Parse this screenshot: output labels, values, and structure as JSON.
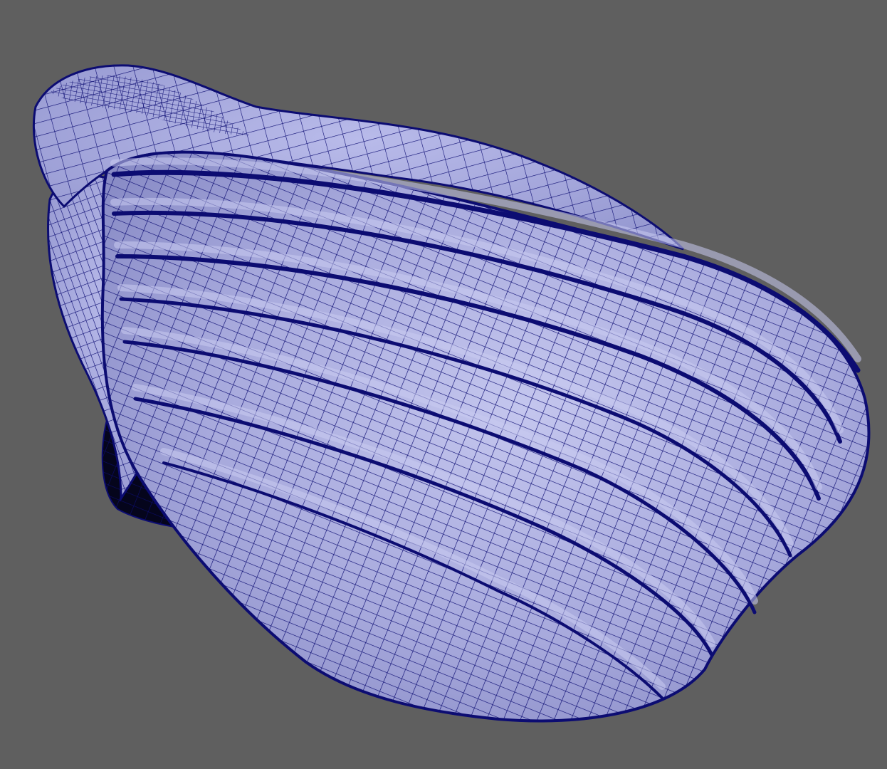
{
  "viewport": {
    "background_color": "#5f5f5f",
    "display_mode": "wireframe-on-shaded",
    "model": {
      "kind": "shell-mesh",
      "shaded_color": "#a7a9dc",
      "shaded_highlight": "#c4c6ee",
      "shaded_dark": "#7f82bf",
      "wire_color": "#0c0c72",
      "cavity_color": "#05051c"
    }
  }
}
